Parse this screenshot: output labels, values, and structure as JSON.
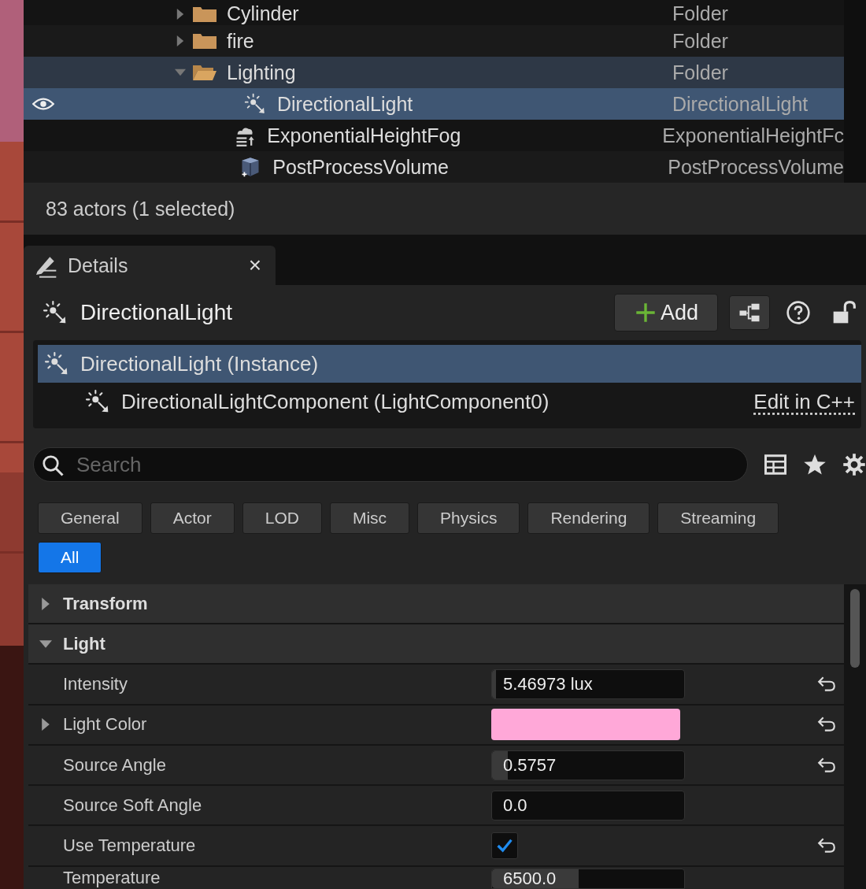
{
  "outliner": {
    "items": [
      {
        "label": "Cylinder",
        "type": "Folder",
        "kind": "folder",
        "expanded": false,
        "selected": false,
        "highlighted": false,
        "eye_shown": false
      },
      {
        "label": "fire",
        "type": "Folder",
        "kind": "folder",
        "expanded": false,
        "selected": false,
        "highlighted": false,
        "eye_shown": false
      },
      {
        "label": "Lighting",
        "type": "Folder",
        "kind": "folder",
        "expanded": true,
        "selected": false,
        "highlighted": true,
        "eye_shown": false,
        "children": [
          {
            "label": "DirectionalLight",
            "type": "DirectionalLight",
            "kind": "light",
            "selected": true,
            "highlighted": false,
            "eye_shown": true
          },
          {
            "label": "ExponentialHeightFog",
            "type": "ExponentialHeightFc",
            "kind": "fog",
            "selected": false,
            "highlighted": false,
            "eye_shown": false
          },
          {
            "label": "PostProcessVolume",
            "type": "PostProcessVolume",
            "kind": "volume",
            "selected": false,
            "highlighted": false,
            "eye_shown": false
          }
        ]
      }
    ],
    "status": "83 actors (1 selected)"
  },
  "details": {
    "tab": {
      "label": "Details",
      "close": "×"
    },
    "actor": "DirectionalLight",
    "add_button": "Add",
    "components": [
      {
        "label": "DirectionalLight (Instance)",
        "selected": true
      },
      {
        "label": "DirectionalLightComponent (LightComponent0)",
        "selected": false,
        "link": "Edit in C++"
      }
    ],
    "search": {
      "placeholder": "Search"
    },
    "filters": [
      {
        "label": "General",
        "selected": false
      },
      {
        "label": "Actor",
        "selected": false
      },
      {
        "label": "LOD",
        "selected": false
      },
      {
        "label": "Misc",
        "selected": false
      },
      {
        "label": "Physics",
        "selected": false
      },
      {
        "label": "Rendering",
        "selected": false
      },
      {
        "label": "Streaming",
        "selected": false
      },
      {
        "label": "All",
        "selected": true
      }
    ],
    "sections": [
      {
        "label": "Transform",
        "expanded": false
      },
      {
        "label": "Light",
        "expanded": true
      }
    ],
    "properties": [
      {
        "label": "Intensity",
        "kind": "number",
        "value": "5.46973 lux",
        "level": 0.02,
        "expandable": false,
        "reset": true
      },
      {
        "label": "Light Color",
        "kind": "color",
        "color": "#ffa8d8",
        "expandable": true,
        "reset": true
      },
      {
        "label": "Source Angle",
        "kind": "number",
        "value": "0.5757",
        "level": 0.08,
        "expandable": false,
        "reset": true
      },
      {
        "label": "Source Soft Angle",
        "kind": "number",
        "value": "0.0",
        "level": 0,
        "expandable": false,
        "reset": false
      },
      {
        "label": "Use Temperature",
        "kind": "checkbox",
        "checked": true,
        "expandable": false,
        "reset": true
      },
      {
        "label": "Temperature",
        "kind": "number",
        "value": "6500.0",
        "level": 0.45,
        "expandable": false,
        "reset": false
      }
    ]
  }
}
